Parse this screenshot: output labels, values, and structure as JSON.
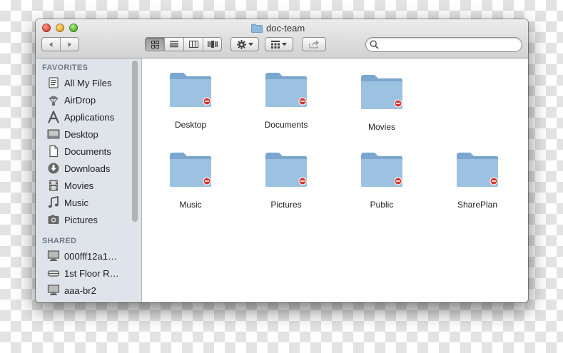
{
  "window": {
    "title": "doc-team"
  },
  "search": {
    "placeholder": "",
    "value": ""
  },
  "sidebar": {
    "favorites_header": "FAVORITES",
    "favorites": [
      {
        "label": "All My Files",
        "icon": "all-files-icon"
      },
      {
        "label": "AirDrop",
        "icon": "airdrop-icon"
      },
      {
        "label": "Applications",
        "icon": "applications-icon"
      },
      {
        "label": "Desktop",
        "icon": "desktop-icon"
      },
      {
        "label": "Documents",
        "icon": "documents-icon"
      },
      {
        "label": "Downloads",
        "icon": "downloads-icon"
      },
      {
        "label": "Movies",
        "icon": "movies-icon"
      },
      {
        "label": "Music",
        "icon": "music-icon"
      },
      {
        "label": "Pictures",
        "icon": "pictures-icon"
      }
    ],
    "shared_header": "SHARED",
    "shared": [
      {
        "label": "000fff12a1…",
        "icon": "monitor-icon"
      },
      {
        "label": "1st Floor R…",
        "icon": "drive-icon"
      },
      {
        "label": "aaa-br2",
        "icon": "monitor-icon"
      }
    ]
  },
  "folders": [
    {
      "label": "Desktop",
      "badge": "no-access-badge"
    },
    {
      "label": "Documents",
      "badge": "no-access-badge"
    },
    {
      "label": "Movies",
      "badge": "no-access-badge"
    },
    {
      "label": "Music",
      "badge": "no-access-badge"
    },
    {
      "label": "Pictures",
      "badge": "no-access-badge"
    },
    {
      "label": "Public",
      "badge": "no-access-badge"
    },
    {
      "label": "SharePlan",
      "badge": "no-access-badge"
    }
  ],
  "colors": {
    "folder": "#9dc1e0",
    "badge": "#d9342b",
    "sidebar": "#dfe4ea"
  }
}
